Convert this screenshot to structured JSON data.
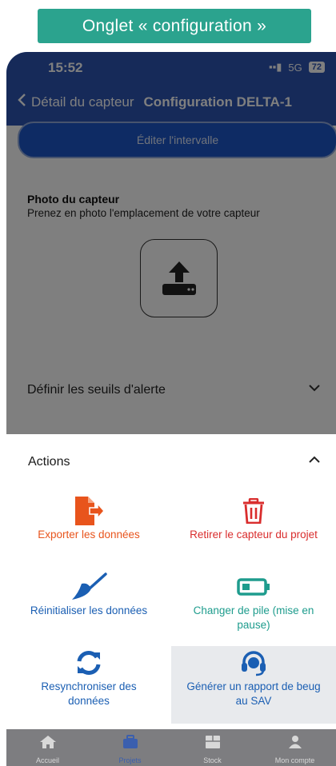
{
  "banner": {
    "title": "Onglet « configuration »"
  },
  "status": {
    "time": "15:52",
    "network": "5G",
    "battery": "72"
  },
  "header": {
    "back_label": "Détail du capteur",
    "title": "Configuration DELTA-1"
  },
  "edit_button": {
    "label": "Éditer l'intervalle"
  },
  "photo": {
    "title": "Photo du capteur",
    "subtitle": "Prenez en photo l'emplacement de votre capteur"
  },
  "thresholds": {
    "label": "Définir les seuils d'alerte"
  },
  "actions": {
    "title": "Actions",
    "items": [
      {
        "label": "Exporter les données",
        "icon": "file-export-icon",
        "color": "#e8541c"
      },
      {
        "label": "Retirer le capteur du projet",
        "icon": "trash-icon",
        "color": "#d92d2d"
      },
      {
        "label": "Réinitialiser les données",
        "icon": "broom-icon",
        "color": "#1b5fb3"
      },
      {
        "label": "Changer de pile (mise en pause)",
        "icon": "battery-icon",
        "color": "#1e9c8d"
      },
      {
        "label": "Resynchroniser des données",
        "icon": "sync-icon",
        "color": "#1b5fb3"
      },
      {
        "label": "Générer un rapport de beug au SAV",
        "icon": "headset-icon",
        "color": "#1b5fb3"
      }
    ]
  },
  "tabs": [
    {
      "label": "Accueil",
      "icon": "home-icon"
    },
    {
      "label": "Projets",
      "icon": "briefcase-icon",
      "active": true
    },
    {
      "label": "Stock",
      "icon": "box-icon"
    },
    {
      "label": "Mon compte",
      "icon": "user-icon"
    }
  ]
}
